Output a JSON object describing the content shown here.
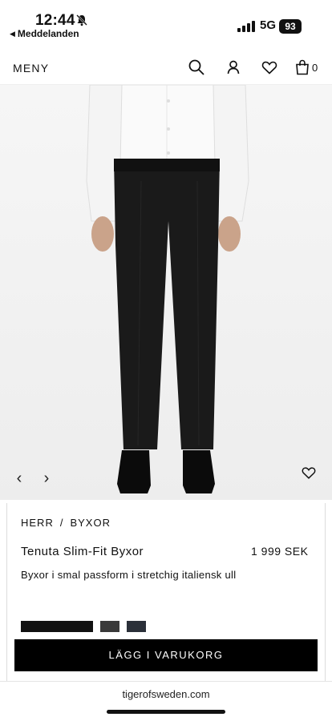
{
  "status": {
    "time": "12:44",
    "back_app": "Meddelanden",
    "network": "5G",
    "battery": "93"
  },
  "header": {
    "menu_label": "MENY",
    "cart_count": "0"
  },
  "product": {
    "breadcrumb": [
      "HERR",
      "BYXOR"
    ],
    "breadcrumb_sep": "/",
    "name": "Tenuta Slim-Fit Byxor",
    "price": "1 999 SEK",
    "description": "Byxor i smal passform i stretchig italiensk ull",
    "swatch_colors": [
      "#111111",
      "#3a3a3a",
      "#2b3039"
    ],
    "add_to_cart_label": "LÄGG I VARUKORG"
  },
  "browser": {
    "url": "tigerofsweden.com"
  },
  "icons": {
    "bell": "bell-slash-icon",
    "search": "search-icon",
    "account": "user-icon",
    "wishlist": "heart-icon",
    "cart": "shopping-bag-icon",
    "prev": "chevron-left-icon",
    "next": "chevron-right-icon"
  }
}
